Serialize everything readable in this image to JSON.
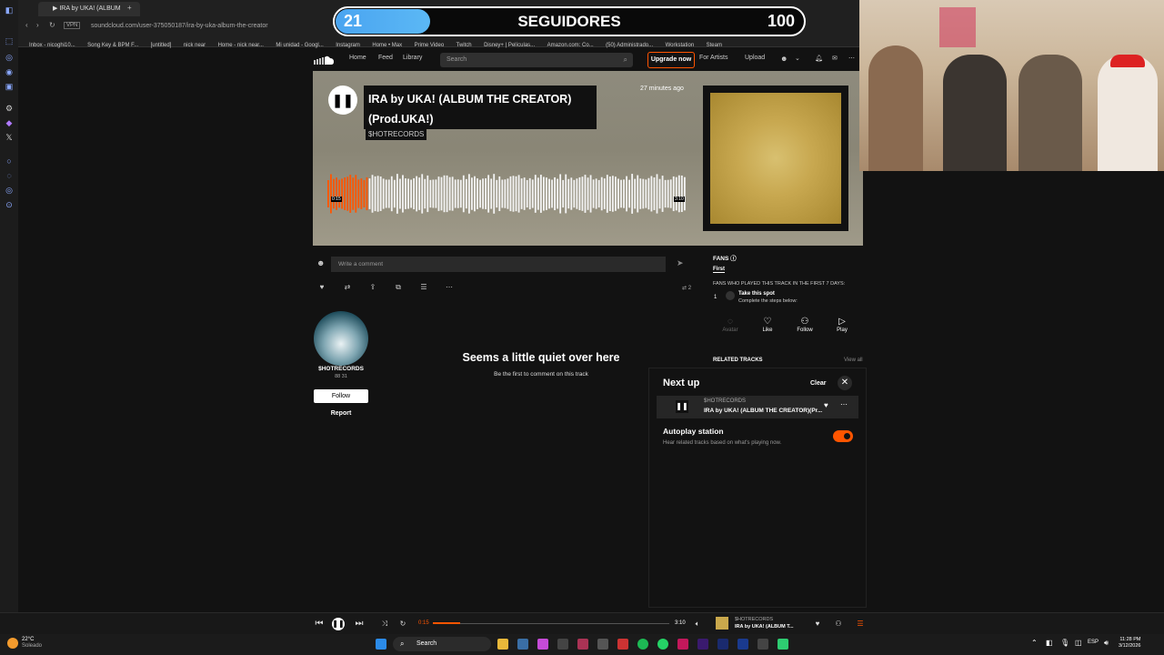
{
  "overlay": {
    "left_count": "21",
    "label": "SEGUIDORES",
    "goal": "100"
  },
  "browser": {
    "tab_title": "▶ IRA by UKA! (ALBUM",
    "url": "soundcloud.com/user-375050187/ira-by-uka-album-the-creator",
    "bookmarks": [
      "Inbox - nicoghi10...",
      "Song Key & BPM F...",
      "[untitled]",
      "nick near",
      "Home - nick near...",
      "Mi unidad - Googl...",
      "Instagram",
      "Home • Max",
      "Prime Video",
      "Twitch",
      "Disney+ | Películas...",
      "Amazon.com: Co...",
      "(50) Administrado...",
      "Workstation",
      "Steam"
    ]
  },
  "header": {
    "home": "Home",
    "feed": "Feed",
    "library": "Library",
    "search_placeholder": "Search",
    "upgrade": "Upgrade now",
    "for_artists": "For Artists",
    "upload": "Upload"
  },
  "track": {
    "title": "IRA by UKA! (ALBUM THE CREATOR) (Prod.UKA!)",
    "artist": "$HOTRECORDS",
    "posted": "27 minutes ago",
    "elapsed": "0:15",
    "total": "3:10"
  },
  "comment": {
    "placeholder": "Write a comment",
    "reposts": "2"
  },
  "artist": {
    "name": "$HOTRECORDS",
    "stats": "88   31",
    "follow": "Follow",
    "report": "Report"
  },
  "empty": {
    "title": "Seems a little quiet over here",
    "subtitle": "Be the first to comment on this track"
  },
  "fans": {
    "title": "FANS",
    "tab": "First",
    "desc": "FANS WHO PLAYED THIS TRACK IN THE FIRST 7 DAYS:",
    "rank": "1",
    "spot": "Take this spot",
    "steps": "Complete the steps below:",
    "avatar": "Avatar",
    "like": "Like",
    "follow": "Follow",
    "play": "Play"
  },
  "related": {
    "title": "RELATED TRACKS",
    "view_all": "View all"
  },
  "next_up": {
    "title": "Next up",
    "clear": "Clear",
    "track_artist": "$HOTRECORDS",
    "track_name": "IRA by UKA! (ALBUM THE CREATOR)(Pr...",
    "autoplay_title": "Autoplay station",
    "autoplay_desc": "Hear related tracks based on what's playing now.",
    "autoplay_on": true
  },
  "player": {
    "elapsed": "0:15",
    "total": "3:10",
    "artist": "$HOTRECORDS",
    "title": "IRA by UKA! (ALBUM T...",
    "progress": 0.08
  },
  "taskbar": {
    "temp": "22°C",
    "weather": "Soleado",
    "search": "Search",
    "time": "11:28 PM",
    "date": "3/12/2026"
  },
  "colors": {
    "accent": "#ff5500",
    "overlay_blue": "#4aa4f0"
  }
}
